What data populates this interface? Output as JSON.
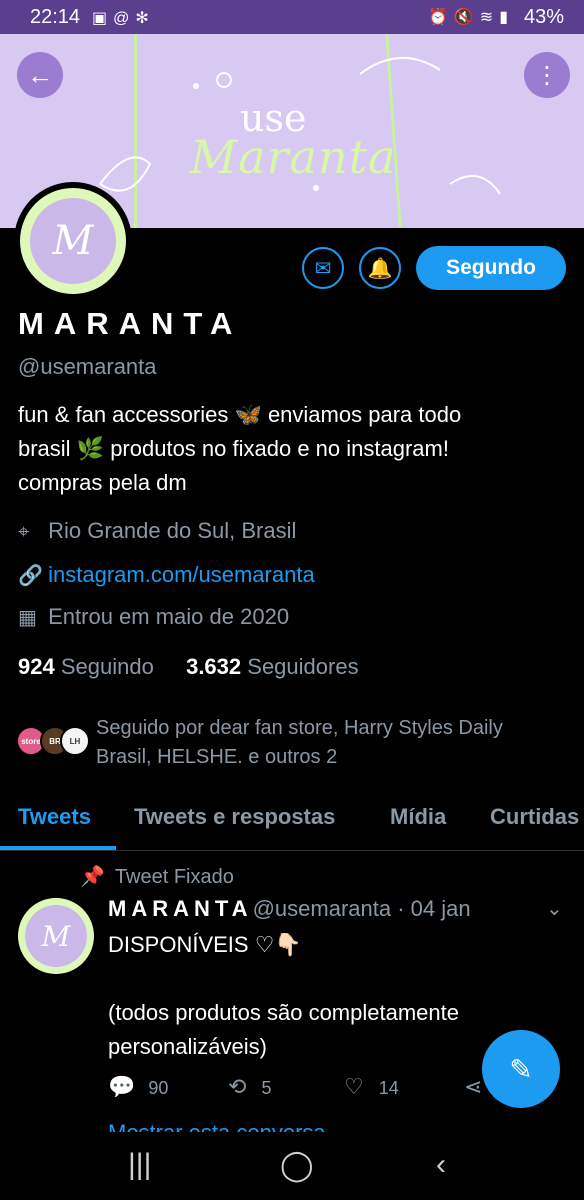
{
  "status_bar": {
    "time": "22:14",
    "battery": "43%",
    "left_icons": [
      "image-icon",
      "at-icon",
      "atom-icon"
    ],
    "right_icons": [
      "alarm-icon",
      "mute-icon",
      "wifi-icon",
      "signal-icon",
      "battery-icon"
    ]
  },
  "banner": {
    "line1": "use",
    "line2": "Maranta",
    "background": "#d8c9f2",
    "accent": "#d9f7a6"
  },
  "profile": {
    "avatar_text": "M",
    "name": "MARANTA",
    "handle": "@usemaranta",
    "bio_lines": [
      "fun & fan accessories 🦋 enviamos para todo",
      "brasil 🌿 produtos no fixado e no instagram!",
      "compras pela dm"
    ],
    "location": "Rio Grande do Sul, Brasil",
    "website": "instagram.com/usemaranta",
    "joined": "Entrou em maio de 2020",
    "following_count": "924",
    "following_label": "Seguindo",
    "followers_count": "3.632",
    "followers_label": "Seguidores",
    "follow_button": "Segundo",
    "followed_by_line1": "Seguido por dear fan store, Harry Styles Daily",
    "followed_by_line2": "Brasil, HELSHE. e outros 2",
    "mini_avatars": [
      "store",
      "BR",
      "LH"
    ]
  },
  "tabs": [
    "Tweets",
    "Tweets e respostas",
    "Mídia",
    "Curtidas"
  ],
  "pinned_tweet": {
    "pinned_label": "Tweet Fixado",
    "author_name": "MARANTA",
    "author_handle_date": "@usemaranta · 04 jan",
    "line1": "DISPONÍVEIS ♡👇🏻",
    "line2": "(todos produtos são completamente",
    "line3": "personalizáveis)",
    "replies": "90",
    "retweets": "5",
    "likes": "14",
    "show_thread": "Mostrar esta conversa"
  },
  "accent_color": "#1d9bf0"
}
